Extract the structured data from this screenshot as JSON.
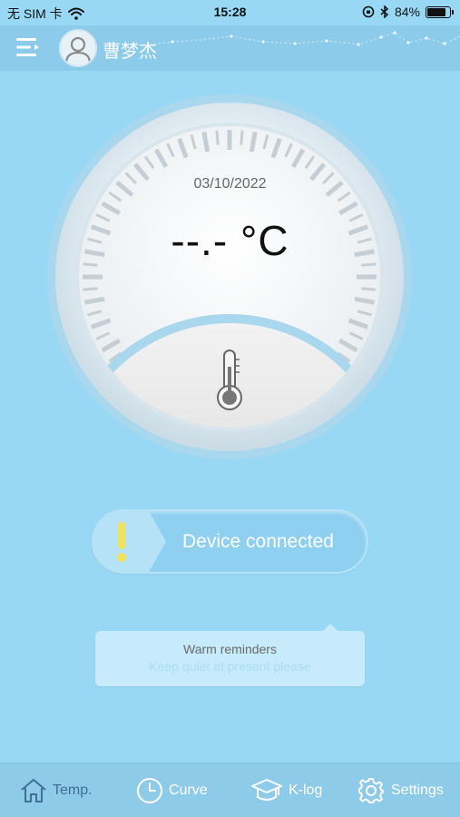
{
  "status_bar": {
    "carrier": "无 SIM 卡",
    "time": "15:28",
    "battery_percent": "84%",
    "battery_level": 0.84,
    "icons": [
      "wifi-icon",
      "orientation-lock-icon",
      "bluetooth-icon",
      "battery-icon"
    ]
  },
  "header": {
    "user_name": "曹梦杰",
    "icons": [
      "menu-icon",
      "avatar-icon"
    ]
  },
  "gauge": {
    "date": "03/10/2022",
    "temperature": "--.-",
    "unit": "°C",
    "icon": "thermometer-icon"
  },
  "device_status": {
    "label": "Device connected",
    "icon": "exclamation-icon",
    "accent": "#f3e35a"
  },
  "reminder": {
    "title": "Warm reminders",
    "message": "Keep quiet at present please"
  },
  "tabs": [
    {
      "label": "Temp.",
      "icon": "home-icon",
      "active": true
    },
    {
      "label": "Curve",
      "icon": "clock-icon",
      "active": false
    },
    {
      "label": "K-log",
      "icon": "graduation-cap-icon",
      "active": false
    },
    {
      "label": "Settings",
      "icon": "gear-icon",
      "active": false
    }
  ],
  "colors": {
    "background": "#98d8f4",
    "header": "#8ccbe9",
    "active_tab": "#3f6f95"
  }
}
